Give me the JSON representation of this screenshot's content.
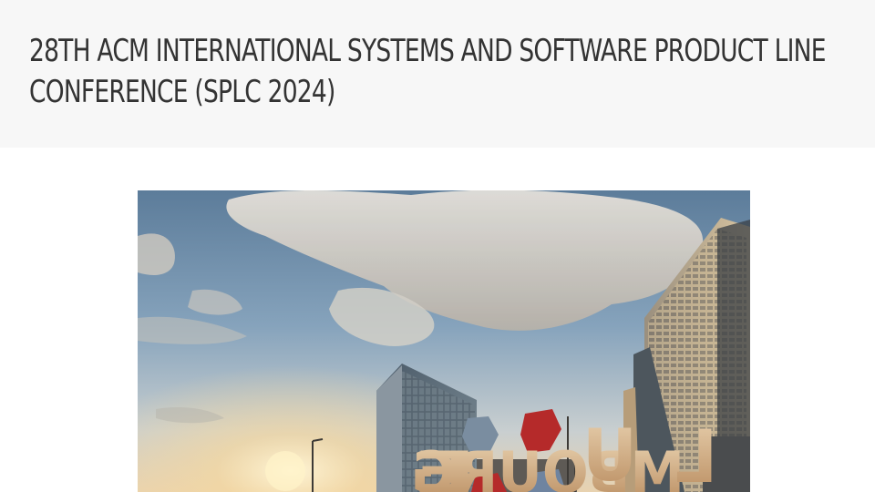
{
  "page": {
    "title_lines": [
      "28TH ACM INTERNATIONAL SYSTEMS AND SOFTWARE PRODUCT LINE",
      "CONFERENCE (SPLC 2024)"
    ]
  },
  "hero_image": {
    "subject": "Luxembourg letters sculpture in front of modern buildings under a cloudy sky",
    "sculpture_text": "LUXEMBOURG"
  }
}
